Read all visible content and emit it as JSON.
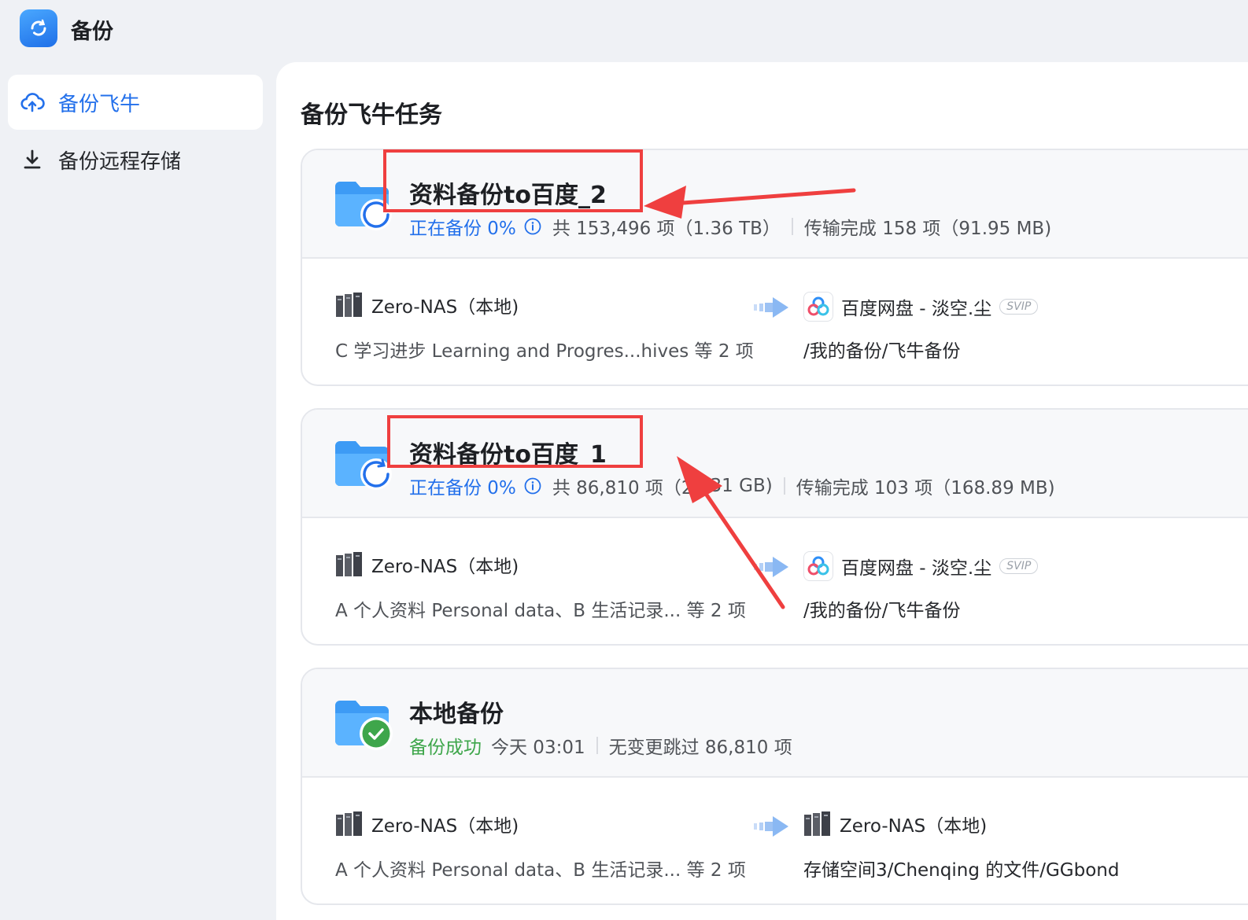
{
  "app": {
    "title": "备份"
  },
  "sidebar": {
    "items": [
      {
        "label": "备份飞牛",
        "icon": "cloud-upload-icon",
        "active": true
      },
      {
        "label": "备份远程存储",
        "icon": "download-icon",
        "active": false
      }
    ]
  },
  "main": {
    "title": "备份飞牛任务",
    "tasks": [
      {
        "name": "资料备份to百度_2",
        "status": "正在备份 0%",
        "total": "共 153,496 项（1.36 TB）",
        "transferred": "传输完成 158 项（91.95 MB)",
        "source_name": "Zero-NAS（本地)",
        "source_items": "C 学习进步 Learning and Progres...hives 等 2 项",
        "dest_name": "百度网盘 - 淡空.尘",
        "dest_badge": "SVIP",
        "dest_path": "/我的备份/飞牛备份"
      },
      {
        "name": "资料备份to百度_1",
        "status": "正在备份 0%",
        "total": "共 86,810 项（2",
        "total_tail": "31 GB)",
        "transferred": "传输完成 103 项（168.89 MB)",
        "source_name": "Zero-NAS（本地)",
        "source_items": "A 个人资料 Personal data、B 生活记录... 等 2 项",
        "dest_name": "百度网盘 - 淡空.尘",
        "dest_badge": "SVIP",
        "dest_path": "/我的备份/飞牛备份"
      },
      {
        "name": "本地备份",
        "status": "备份成功",
        "time": "今天 03:01",
        "skipped": "无变更跳过 86,810 项",
        "source_name": "Zero-NAS（本地)",
        "source_items": "A 个人资料 Personal data、B 生活记录... 等 2 项",
        "dest_name": "Zero-NAS（本地)",
        "dest_path": "存储空间3/Chenqing 的文件/GGbond"
      }
    ]
  },
  "colors": {
    "accent": "#2370eb",
    "success": "#3ea64b",
    "highlight": "#ef3f3f"
  }
}
